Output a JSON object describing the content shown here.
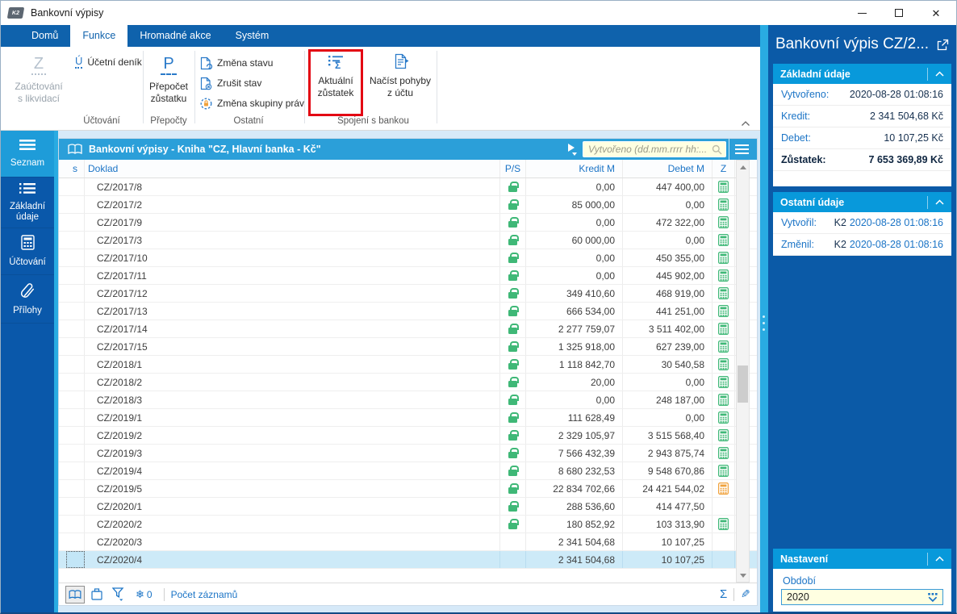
{
  "window": {
    "title": "Bankovní výpisy"
  },
  "icons": {
    "close": "✕",
    "sigma": "Σ",
    "pencil": "✎",
    "snowflake": "❄",
    "collapse": "⌃"
  },
  "colors": {
    "accent_blue": "#0f62ac",
    "cyan": "#29abe2",
    "table_title": "#2b9fd9",
    "green": "#3fb877",
    "orange": "#f0a23c",
    "selected_row": "#cdeaf8",
    "annotation_red": "#e30613",
    "input_yellow": "#ffffe1"
  },
  "ribbon": {
    "tabs": [
      "Domů",
      "Funkce",
      "Hromadné akce",
      "Systém"
    ],
    "active_tab": "Funkce",
    "groups": {
      "uctovani": {
        "label": "Účtování",
        "big_button": {
          "letter": "Z",
          "line1": "Zaúčtování",
          "line2": "s likvidací"
        },
        "small_button": {
          "letter": "Ú",
          "label": "Účetní deník"
        }
      },
      "prepocty": {
        "label": "Přepočty",
        "big_button": {
          "letter": "P",
          "line1": "Přepočet",
          "line2": "zůstatku"
        }
      },
      "ostatni": {
        "label": "Ostatní",
        "items": [
          "Změna stavu",
          "Zrušit stav",
          "Změna skupiny práv"
        ]
      },
      "spojeni": {
        "label": "Spojení s bankou",
        "aktualni": {
          "line1": "Aktuální",
          "line2": "zůstatek"
        },
        "nacist": {
          "line1": "Načíst pohyby",
          "line2": "z účtu"
        }
      }
    }
  },
  "sidebar": {
    "active": "Seznam",
    "items": [
      {
        "label": "Seznam",
        "icon": "list-icon"
      },
      {
        "label": "Základní údaje",
        "icon": "detail-list-icon"
      },
      {
        "label": "Účtování",
        "icon": "calculator-icon"
      },
      {
        "label": "Přílohy",
        "icon": "paperclip-icon"
      }
    ]
  },
  "table": {
    "title": "Bankovní výpisy - Kniha \"CZ, Hlavní banka - Kč\"",
    "search_placeholder": "Vytvořeno (dd.mm.rrrr hh:...",
    "columns": [
      "s",
      "Doklad",
      "P/S",
      "Kredit M",
      "Debet M",
      "Z"
    ],
    "rows": [
      {
        "doklad": "CZ/2017/8",
        "lock": true,
        "kredit": "0,00",
        "debet": "447 400,00",
        "calc": "green"
      },
      {
        "doklad": "CZ/2017/2",
        "lock": true,
        "kredit": "85 000,00",
        "debet": "0,00",
        "calc": "green"
      },
      {
        "doklad": "CZ/2017/9",
        "lock": true,
        "kredit": "0,00",
        "debet": "472 322,00",
        "calc": "green"
      },
      {
        "doklad": "CZ/2017/3",
        "lock": true,
        "kredit": "60 000,00",
        "debet": "0,00",
        "calc": "green"
      },
      {
        "doklad": "CZ/2017/10",
        "lock": true,
        "kredit": "0,00",
        "debet": "450 355,00",
        "calc": "green"
      },
      {
        "doklad": "CZ/2017/11",
        "lock": true,
        "kredit": "0,00",
        "debet": "445 902,00",
        "calc": "green"
      },
      {
        "doklad": "CZ/2017/12",
        "lock": true,
        "kredit": "349 410,60",
        "debet": "468 919,00",
        "calc": "green"
      },
      {
        "doklad": "CZ/2017/13",
        "lock": true,
        "kredit": "666 534,00",
        "debet": "441 251,00",
        "calc": "green"
      },
      {
        "doklad": "CZ/2017/14",
        "lock": true,
        "kredit": "2 277 759,07",
        "debet": "3 511 402,00",
        "calc": "green"
      },
      {
        "doklad": "CZ/2017/15",
        "lock": true,
        "kredit": "1 325 918,00",
        "debet": "627 239,00",
        "calc": "green"
      },
      {
        "doklad": "CZ/2018/1",
        "lock": true,
        "kredit": "1 118 842,70",
        "debet": "30 540,58",
        "calc": "green"
      },
      {
        "doklad": "CZ/2018/2",
        "lock": true,
        "kredit": "20,00",
        "debet": "0,00",
        "calc": "green"
      },
      {
        "doklad": "CZ/2018/3",
        "lock": true,
        "kredit": "0,00",
        "debet": "248 187,00",
        "calc": "green"
      },
      {
        "doklad": "CZ/2019/1",
        "lock": true,
        "kredit": "111 628,49",
        "debet": "0,00",
        "calc": "green"
      },
      {
        "doklad": "CZ/2019/2",
        "lock": true,
        "kredit": "2 329 105,97",
        "debet": "3 515 568,40",
        "calc": "green"
      },
      {
        "doklad": "CZ/2019/3",
        "lock": true,
        "kredit": "7 566 432,39",
        "debet": "2 943 875,74",
        "calc": "green"
      },
      {
        "doklad": "CZ/2019/4",
        "lock": true,
        "kredit": "8 680 232,53",
        "debet": "9 548 670,86",
        "calc": "green"
      },
      {
        "doklad": "CZ/2019/5",
        "lock": true,
        "kredit": "22 834 702,66",
        "debet": "24 421 544,02",
        "calc": "orange"
      },
      {
        "doklad": "CZ/2020/1",
        "lock": true,
        "kredit": "288 536,60",
        "debet": "414 477,50",
        "calc": null
      },
      {
        "doklad": "CZ/2020/2",
        "lock": true,
        "kredit": "180 852,92",
        "debet": "103 313,90",
        "calc": "green"
      },
      {
        "doklad": "CZ/2020/3",
        "lock": false,
        "kredit": "2 341 504,68",
        "debet": "10 107,25",
        "calc": null
      },
      {
        "doklad": "CZ/2020/4",
        "lock": false,
        "kredit": "2 341 504,68",
        "debet": "10 107,25",
        "calc": null,
        "selected": true
      }
    ],
    "status": {
      "freeze_count": "0",
      "records_label": "Počet záznamů"
    }
  },
  "detail": {
    "title": "Bankovní výpis CZ/2...",
    "zakladni": {
      "title": "Základní údaje",
      "rows": [
        {
          "label": "Vytvořeno:",
          "value": "2020-08-28 01:08:16"
        },
        {
          "label": "Kredit:",
          "value": "2 341 504,68 Kč"
        },
        {
          "label": "Debet:",
          "value": "10 107,25 Kč"
        },
        {
          "label": "Zůstatek:",
          "value": "7 653 369,89 Kč"
        }
      ]
    },
    "ostatni": {
      "title": "Ostatní údaje",
      "rows": [
        {
          "label": "Vytvořil:",
          "prefix": "K2",
          "value": "2020-08-28 01:08:16"
        },
        {
          "label": "Změnil:",
          "prefix": "K2",
          "value": "2020-08-28 01:08:16"
        }
      ]
    },
    "nastaveni": {
      "title": "Nastavení",
      "field_label": "Období",
      "field_value": "2020"
    }
  }
}
